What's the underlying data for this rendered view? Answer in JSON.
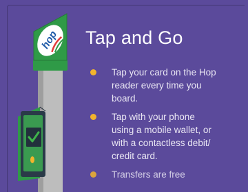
{
  "title": "Tap and Go",
  "logo_text": "hop",
  "bullets": [
    {
      "lines": [
        "Tap your card on the Hop",
        "reader every time you",
        "board."
      ]
    },
    {
      "lines": [
        "Tap with your phone",
        "using a mobile wallet, or",
        "with a contactless debit/",
        "credit card."
      ]
    },
    {
      "lines": [
        "Transfers are free"
      ]
    }
  ],
  "colors": {
    "background": "#5b4a9b",
    "accent_green": "#2f9a47",
    "bullet_yellow": "#f2b42c",
    "pole_gray": "#b3b3b3",
    "reader_body": "#2a3a48",
    "reader_check": "#3fb44b",
    "logo_blue": "#1e5aa8",
    "logo_red": "#e23b3b"
  },
  "icons": [
    "hop-logo",
    "card-reader-icon",
    "checkmark-icon",
    "bullet-dot-icon"
  ]
}
